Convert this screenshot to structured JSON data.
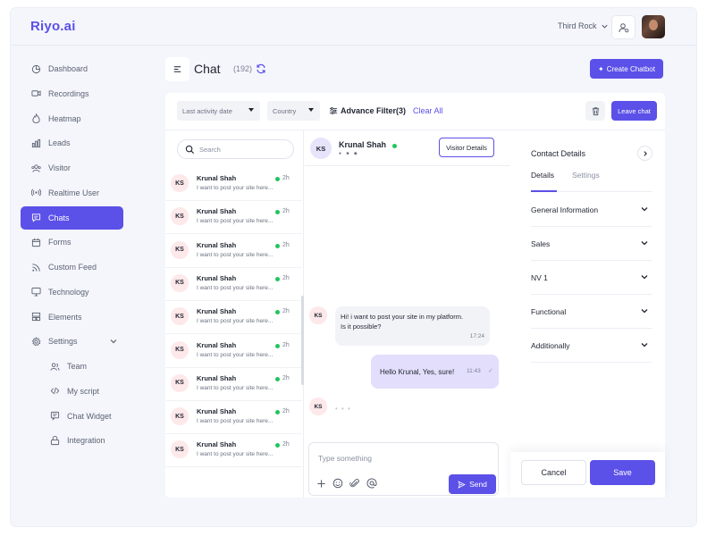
{
  "app": {
    "logo": "Riyo.ai",
    "accent": "#5b50e8",
    "online_color": "#22c55e"
  },
  "topbar": {
    "org_name": "Third Rock"
  },
  "sidebar": {
    "items": [
      {
        "label": "Dashboard",
        "icon": "dashboard-icon"
      },
      {
        "label": "Recordings",
        "icon": "video-icon"
      },
      {
        "label": "Heatmap",
        "icon": "heatmap-icon"
      },
      {
        "label": "Leads",
        "icon": "bar-chart-icon"
      },
      {
        "label": "Visitor",
        "icon": "visitor-icon"
      },
      {
        "label": "Realtime User",
        "icon": "broadcast-icon"
      },
      {
        "label": "Chats",
        "icon": "chat-icon",
        "active": true
      },
      {
        "label": "Forms",
        "icon": "calendar-icon"
      },
      {
        "label": "Custom Feed",
        "icon": "rss-icon"
      },
      {
        "label": "Technology",
        "icon": "monitor-icon"
      },
      {
        "label": "Elements",
        "icon": "elements-icon"
      },
      {
        "label": "Settings",
        "icon": "settings-icon",
        "expanded": true
      }
    ],
    "sub_items": [
      {
        "label": "Team",
        "icon": "team-icon"
      },
      {
        "label": "My script",
        "icon": "code-icon"
      },
      {
        "label": "Chat Widget",
        "icon": "widget-icon"
      },
      {
        "label": "Integration",
        "icon": "integration-icon"
      }
    ]
  },
  "header": {
    "title": "Chat",
    "count": "(192)",
    "create_label": "Create Chatbot"
  },
  "filters": {
    "date_placeholder": "Last activity date",
    "country_placeholder": "Country",
    "advance_label": "Advance Filter(3)",
    "clear_label": "Clear All",
    "leave_label": "Leave chat"
  },
  "conversations": {
    "search_placeholder": "Search",
    "items": [
      {
        "initials": "KS",
        "name": "Krunal Shah",
        "preview": "I want to post your site here...",
        "time": "2h"
      },
      {
        "initials": "KS",
        "name": "Krunal Shah",
        "preview": "I want to post your site here...",
        "time": "2h"
      },
      {
        "initials": "KS",
        "name": "Krunal Shah",
        "preview": "I want to post your site here...",
        "time": "2h"
      },
      {
        "initials": "KS",
        "name": "Krunal Shah",
        "preview": "I want to post your site here...",
        "time": "2h"
      },
      {
        "initials": "KS",
        "name": "Krunal Shah",
        "preview": "I want to post your site here...",
        "time": "2h"
      },
      {
        "initials": "KS",
        "name": "Krunal Shah",
        "preview": "I want to post your site here...",
        "time": "2h"
      },
      {
        "initials": "KS",
        "name": "Krunal Shah",
        "preview": "I want to post your site here...",
        "time": "2h"
      },
      {
        "initials": "KS",
        "name": "Krunal Shah",
        "preview": "I want to post your site here...",
        "time": "2h"
      },
      {
        "initials": "KS",
        "name": "Krunal Shah",
        "preview": "I want to post your site here...",
        "time": "2h"
      }
    ]
  },
  "chat": {
    "contact_initials": "KS",
    "contact_name": "Krunal Shah",
    "visitor_details_label": "Visitor Details",
    "incoming_initials": "KS",
    "incoming_line1": "Hi! i want  to post your site in my platform.",
    "incoming_line2": "Is it possible?",
    "incoming_time": "17:24",
    "outgoing_text": "Hello Krunal, Yes, sure!",
    "outgoing_time": "11:43",
    "typing_initials": "KS",
    "typing_dots": "• • •",
    "input_placeholder": "Type something",
    "send_label": "Send"
  },
  "details": {
    "title": "Contact Details",
    "tabs": [
      "Details",
      "Settings"
    ],
    "sections": [
      "General Information",
      "Sales",
      "NV 1",
      "Functional",
      "Additionally"
    ],
    "cancel_label": "Cancel",
    "save_label": "Save"
  }
}
